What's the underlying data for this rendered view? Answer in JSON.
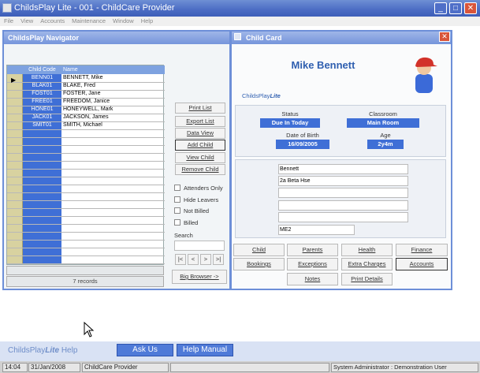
{
  "window": {
    "title": "ChildsPlay Lite - 001 - ChildCare Provider"
  },
  "menu": [
    "File",
    "View",
    "Accounts",
    "Maintenance",
    "Window",
    "Help"
  ],
  "navigator": {
    "title": "ChildsPlay Navigator",
    "columns": [
      "Child Code",
      "Name"
    ],
    "rows": [
      {
        "code": "BENN01",
        "name": "BENNETT, Mike"
      },
      {
        "code": "BLAK01",
        "name": "BLAKE, Fred"
      },
      {
        "code": "FOST01",
        "name": "FOSTER, Jane"
      },
      {
        "code": "FREE01",
        "name": "FREEDOM, Janice"
      },
      {
        "code": "HONE01",
        "name": "HONEYWELL, Mark"
      },
      {
        "code": "JACK01",
        "name": "JACKSON, James"
      },
      {
        "code": "SMIT01",
        "name": "SMITH, Michael"
      }
    ],
    "records": "7 records",
    "buttons": {
      "print_list": "Print List",
      "export_list": "Export List",
      "data_view": "Data View",
      "add_child": "Add Child",
      "view_child": "View Child",
      "remove_child": "Remove Child",
      "big_browser": "Big Browser ->"
    },
    "filters": {
      "attenders_only": "Attenders Only",
      "hide_leavers": "Hide Leavers",
      "not_billed": "Not Billed",
      "billed": "Billed"
    },
    "search_label": "Search",
    "nav": {
      "first": "|<",
      "prev": "<",
      "next": ">",
      "last": ">|"
    }
  },
  "child_card": {
    "title": "Child Card",
    "name": "Mike Bennett",
    "brand": "ChildsPlay",
    "brand_suffix": "Lite",
    "status_label": "Status",
    "status_value": "Due In Today",
    "classroom_label": "Classroom",
    "classroom_value": "Main Room",
    "dob_label": "Date of Birth",
    "dob_value": "16/09/2005",
    "age_label": "Age",
    "age_value": "2y4m",
    "address": [
      "Bennett",
      "2a Beta Hse",
      "",
      "",
      "",
      ""
    ],
    "postcode": "ME2",
    "buttons": {
      "child": "Child",
      "parents": "Parents",
      "health": "Health",
      "finance": "Finance",
      "bookings": "Bookings",
      "exceptions": "Exceptions",
      "extra_charges": "Extra Charges",
      "accounts": "Accounts",
      "notes": "Notes",
      "print_details": "Print Details"
    }
  },
  "helpbar": {
    "brand": "ChildsPlay",
    "brand_suffix": "Lite",
    "brand_help": "Help",
    "ask_us": "Ask Us",
    "help_manual": "Help Manual"
  },
  "statusbar": {
    "time": "14:04",
    "date": "31/Jan/2008",
    "provider": "ChildCare Provider",
    "user": "System Administrator : Demonstration User"
  },
  "colors": {
    "titlebar": "#4b6cc4",
    "panel_border": "#6d8fd8",
    "code_column": "#3f6fd6",
    "name_text": "#2f5fb0"
  }
}
